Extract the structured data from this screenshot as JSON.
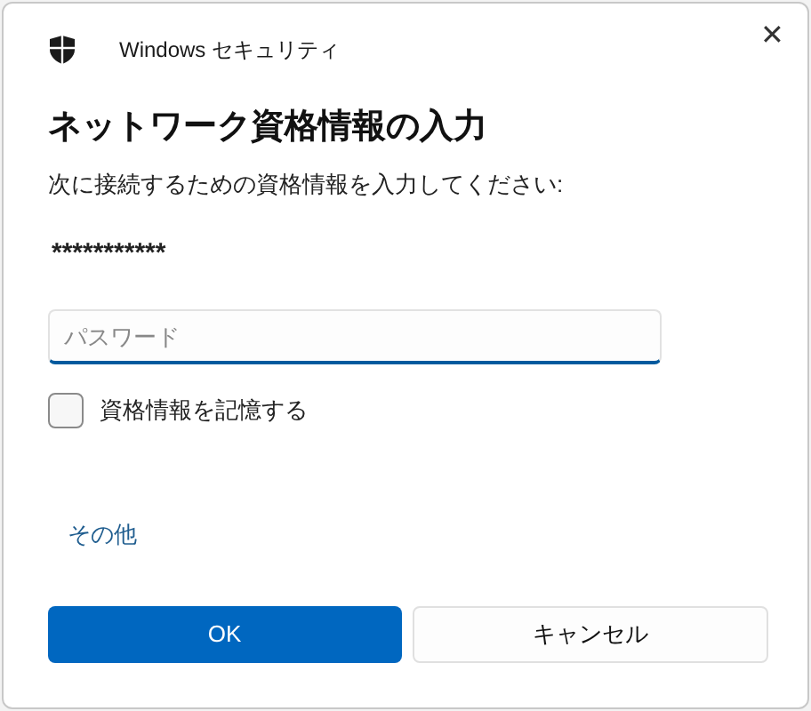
{
  "window": {
    "title": "Windows セキュリティ",
    "close": "✕"
  },
  "heading": "ネットワーク資格情報の入力",
  "instruction": "次に接続するための資格情報を入力してください:",
  "username": "***********",
  "password": {
    "placeholder": "パスワード"
  },
  "remember": {
    "label": "資格情報を記憶する",
    "checked": false
  },
  "more_link": "その他",
  "buttons": [
    {
      "label": "OK",
      "kind": "primary"
    },
    {
      "label": "キャンセル",
      "kind": "secondary"
    }
  ]
}
